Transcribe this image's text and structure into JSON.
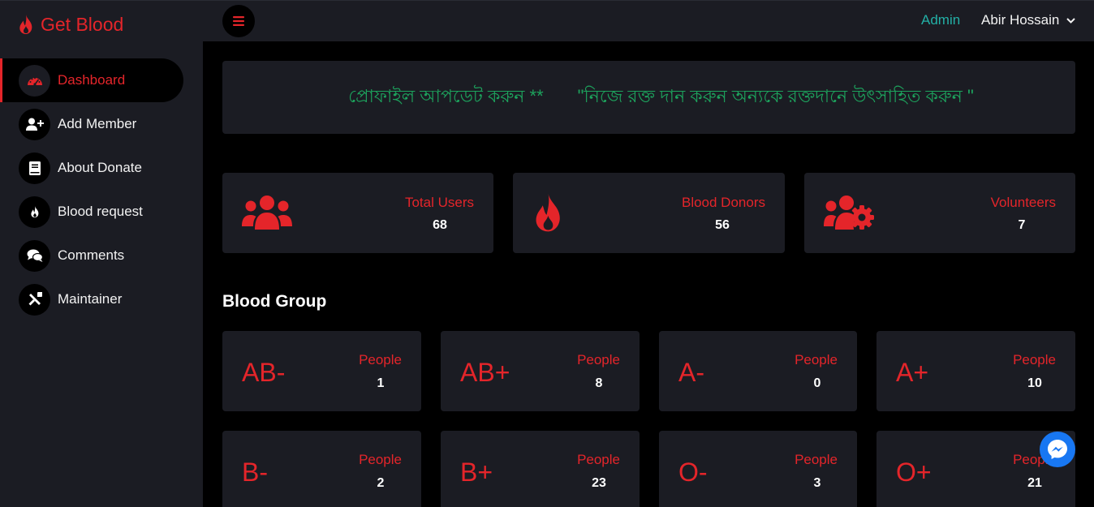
{
  "brand": {
    "name": "Get Blood",
    "icon": "fire-icon"
  },
  "sidebar": {
    "items": [
      {
        "label": "Dashboard",
        "icon": "gauge-icon",
        "active": true
      },
      {
        "label": "Add Member",
        "icon": "user-plus-icon"
      },
      {
        "label": "About Donate",
        "icon": "book-icon"
      },
      {
        "label": "Blood request",
        "icon": "fire-icon"
      },
      {
        "label": "Comments",
        "icon": "comments-icon"
      },
      {
        "label": "Maintainer",
        "icon": "tools-icon"
      }
    ]
  },
  "topbar": {
    "menu_icon": "hamburger-icon",
    "role": "Admin",
    "user_name": "Abir Hossain"
  },
  "notice": {
    "part1": "প্রোফাইল আপডেট করুন **",
    "part2": "\"নিজে রক্ত দান করুন অন্যকে রক্তদানে উৎসাহিত করুন \""
  },
  "stats": [
    {
      "label": "Total Users",
      "value": "68",
      "icon": "users-icon"
    },
    {
      "label": "Blood Donors",
      "value": "56",
      "icon": "fire-icon"
    },
    {
      "label": "Volunteers",
      "value": "7",
      "icon": "users-cog-icon"
    }
  ],
  "blood_group": {
    "title": "Blood Group",
    "people_label": "People",
    "groups": [
      {
        "name": "AB-",
        "count": "1"
      },
      {
        "name": "AB+",
        "count": "8"
      },
      {
        "name": "A-",
        "count": "0"
      },
      {
        "name": "A+",
        "count": "10"
      },
      {
        "name": "B-",
        "count": "2"
      },
      {
        "name": "B+",
        "count": "23"
      },
      {
        "name": "O-",
        "count": "3"
      },
      {
        "name": "O+",
        "count": "21"
      }
    ]
  },
  "colors": {
    "accent": "#e4252a",
    "panel": "#1b1c23",
    "background": "#000000",
    "admin": "#23b0a6",
    "notice": "#1da35d",
    "messenger": "#1877f2"
  },
  "messenger": {
    "icon": "messenger-icon"
  }
}
